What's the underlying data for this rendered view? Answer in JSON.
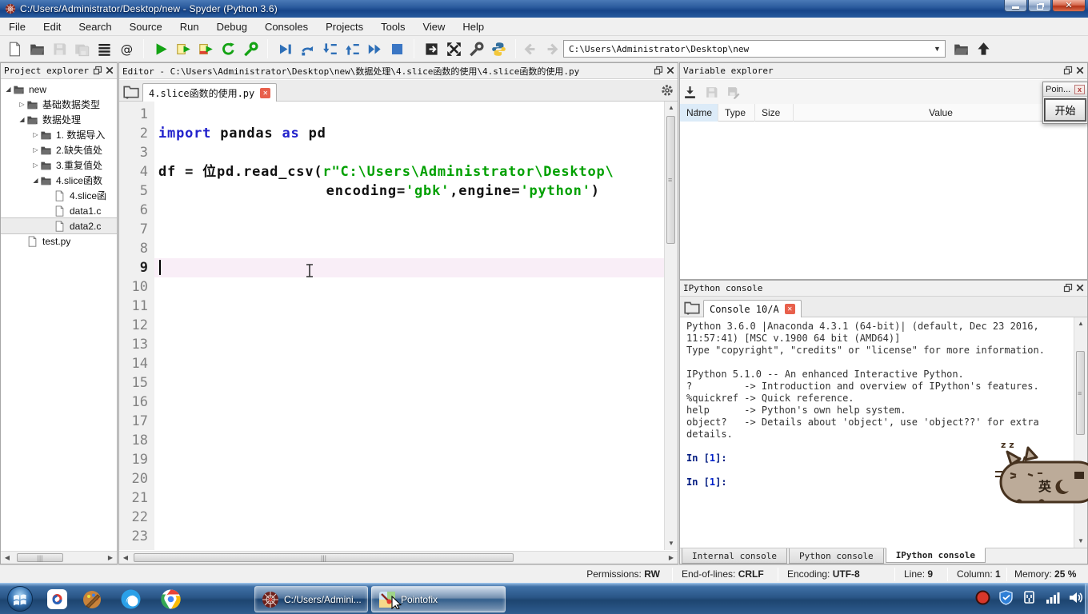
{
  "window": {
    "title": "C:/Users/Administrator/Desktop/new - Spyder (Python 3.6)"
  },
  "menu": {
    "items": [
      "File",
      "Edit",
      "Search",
      "Source",
      "Run",
      "Debug",
      "Consoles",
      "Projects",
      "Tools",
      "View",
      "Help"
    ]
  },
  "toolbar": {
    "groups": [
      [
        "new-file",
        "open-folder",
        "save",
        "save-all",
        "file-switcher",
        "symbol-finder"
      ],
      [
        "run",
        "run-cell",
        "run-cell-advance",
        "rerun",
        "run-config"
      ],
      [
        "debug-file",
        "step",
        "step-into",
        "step-return",
        "continue",
        "stop-debug"
      ],
      [
        "export",
        "maximize-pane",
        "tools",
        "python-env"
      ]
    ],
    "disabled": [
      "save",
      "save-all"
    ],
    "path_value": "C:\\Users\\Administrator\\Desktop\\new"
  },
  "project": {
    "title": "Project explorer",
    "items": [
      {
        "label": "new",
        "depth": 0,
        "icon": "folder",
        "arrow": "expanded",
        "selected": false
      },
      {
        "label": "基础数据类型",
        "depth": 1,
        "icon": "folder",
        "arrow": "collapsed",
        "selected": false
      },
      {
        "label": "数据处理",
        "depth": 1,
        "icon": "folder",
        "arrow": "expanded",
        "selected": false
      },
      {
        "label": "1. 数据导入",
        "depth": 2,
        "icon": "folder",
        "arrow": "collapsed",
        "selected": false
      },
      {
        "label": "2.缺失值处",
        "depth": 2,
        "icon": "folder",
        "arrow": "collapsed",
        "selected": false
      },
      {
        "label": "3.重复值处",
        "depth": 2,
        "icon": "folder",
        "arrow": "collapsed",
        "selected": false
      },
      {
        "label": "4.slice函数",
        "depth": 2,
        "icon": "folder",
        "arrow": "expanded",
        "selected": false
      },
      {
        "label": "4.slice函",
        "depth": 3,
        "icon": "file",
        "arrow": "none",
        "selected": false
      },
      {
        "label": "data1.c",
        "depth": 3,
        "icon": "file",
        "arrow": "none",
        "selected": false
      },
      {
        "label": "data2.c",
        "depth": 3,
        "icon": "file",
        "arrow": "none",
        "selected": true
      },
      {
        "label": "test.py",
        "depth": 1,
        "icon": "file",
        "arrow": "none",
        "selected": false
      }
    ]
  },
  "editor": {
    "title": "Editor - C:\\Users\\Administrator\\Desktop\\new\\数据处理\\4.slice函数的使用\\4.slice函数的使用.py",
    "tab_label": "4.slice函数的使用.py",
    "current_line": 9,
    "lines": [
      {
        "n": 1,
        "code": []
      },
      {
        "n": 2,
        "code": [
          [
            "kw",
            "import"
          ],
          [
            "plain",
            " pandas "
          ],
          [
            "kw",
            "as"
          ],
          [
            "plain",
            " pd"
          ]
        ]
      },
      {
        "n": 3,
        "code": []
      },
      {
        "n": 4,
        "code": [
          [
            "plain",
            "df = 位pd.read_csv("
          ],
          [
            "str",
            "r\"C:\\Users\\Administrator\\Desktop\\"
          ]
        ]
      },
      {
        "n": 5,
        "code": [
          [
            "plain",
            "                   encoding="
          ],
          [
            "str",
            "'gbk'"
          ],
          [
            "plain",
            ",engine="
          ],
          [
            "str",
            "'python'"
          ],
          [
            "plain",
            ")"
          ]
        ]
      },
      {
        "n": 6,
        "code": []
      },
      {
        "n": 7,
        "code": []
      },
      {
        "n": 8,
        "code": []
      },
      {
        "n": 9,
        "code": []
      },
      {
        "n": 10,
        "code": []
      },
      {
        "n": 11,
        "code": []
      },
      {
        "n": 12,
        "code": []
      },
      {
        "n": 13,
        "code": []
      },
      {
        "n": 14,
        "code": []
      },
      {
        "n": 15,
        "code": []
      },
      {
        "n": 16,
        "code": []
      },
      {
        "n": 17,
        "code": []
      },
      {
        "n": 18,
        "code": []
      },
      {
        "n": 19,
        "code": []
      },
      {
        "n": 20,
        "code": []
      },
      {
        "n": 21,
        "code": []
      },
      {
        "n": 22,
        "code": []
      },
      {
        "n": 23,
        "code": []
      }
    ]
  },
  "variable_explorer": {
    "title": "Variable explorer",
    "columns": [
      "Name",
      "Type",
      "Size",
      "Value"
    ],
    "toolbar": [
      "import-data",
      "save-data",
      "save-data-as"
    ]
  },
  "pointofix": {
    "title": "Poin...",
    "close_glyph": "x",
    "start_label": "开始"
  },
  "console": {
    "title": "IPython console",
    "tab_label": "Console 10/A",
    "lines": [
      {
        "kind": "out",
        "text": "Python 3.6.0 |Anaconda 4.3.1 (64-bit)| (default, Dec 23 2016,"
      },
      {
        "kind": "out",
        "text": "11:57:41) [MSC v.1900 64 bit (AMD64)]"
      },
      {
        "kind": "out",
        "text": "Type \"copyright\", \"credits\" or \"license\" for more information."
      },
      {
        "kind": "blank",
        "text": ""
      },
      {
        "kind": "out",
        "text": "IPython 5.1.0 -- An enhanced Interactive Python."
      },
      {
        "kind": "out",
        "text": "?         -> Introduction and overview of IPython's features."
      },
      {
        "kind": "out",
        "text": "%quickref -> Quick reference."
      },
      {
        "kind": "out",
        "text": "help      -> Python's own help system."
      },
      {
        "kind": "out",
        "text": "object?   -> Details about 'object', use 'object??' for extra"
      },
      {
        "kind": "out",
        "text": "details."
      },
      {
        "kind": "blank",
        "text": ""
      },
      {
        "kind": "prompt",
        "pre": "In [",
        "num": "1",
        "post": "]:"
      },
      {
        "kind": "blank",
        "text": ""
      },
      {
        "kind": "prompt",
        "pre": "In [",
        "num": "1",
        "post": "]:"
      }
    ],
    "bottom_tabs": [
      {
        "label": "Internal console",
        "active": false
      },
      {
        "label": "Python console",
        "active": false
      },
      {
        "label": "IPython console",
        "active": true
      }
    ]
  },
  "statusbar": {
    "permissions_label": "Permissions:",
    "permissions_value": "RW",
    "eol_label": "End-of-lines:",
    "eol_value": "CRLF",
    "enc_label": "Encoding:",
    "enc_value": "UTF-8",
    "line_label": "Line:",
    "line_value": "9",
    "col_label": "Column:",
    "col_value": "1",
    "mem_label": "Memory:",
    "mem_value": "25 %"
  },
  "taskbar": {
    "quick_launch": [
      "sunlogin",
      "paint",
      "browser",
      "chrome"
    ],
    "buttons": [
      {
        "icon": "spyder",
        "label": "C:/Users/Admini..."
      },
      {
        "icon": "pointofix",
        "label": "Pointofix",
        "hot": true
      }
    ],
    "tray": [
      "record",
      "shield",
      "plug",
      "network",
      "volume"
    ]
  },
  "overlay": {
    "cat_zzz": "z z",
    "cat_char": "英"
  },
  "colors": {
    "keyword": "#2222cc",
    "string": "#00a000",
    "prompt": "#001a80",
    "current_line_bg": "#f9eef7",
    "tab_close": "#e8604c",
    "titlebar": "#2c5c9e",
    "taskbar": "#2a5687"
  }
}
